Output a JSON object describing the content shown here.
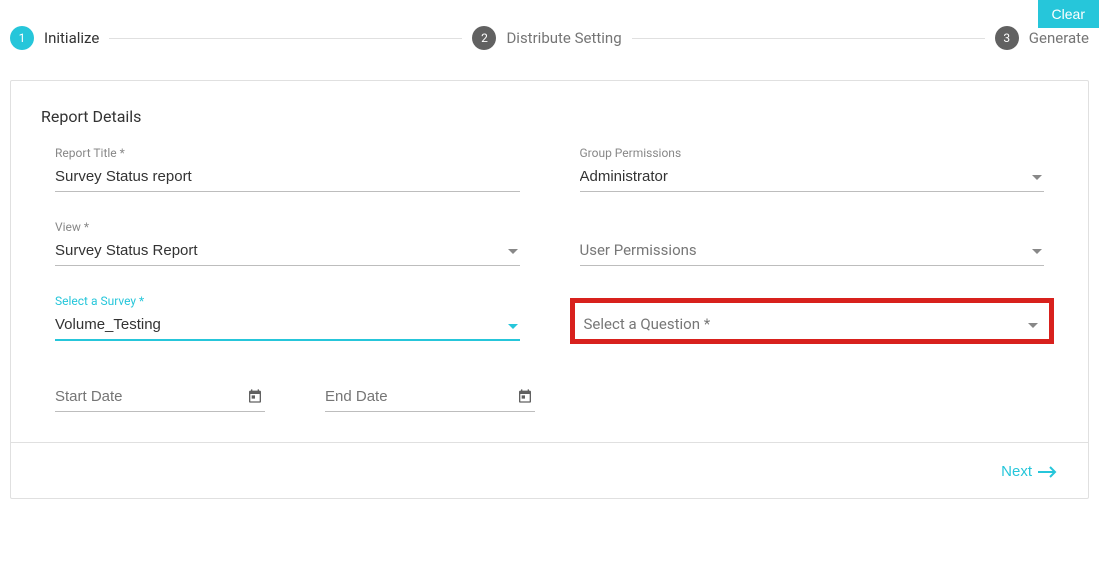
{
  "header": {
    "clear_label": "Clear"
  },
  "stepper": {
    "steps": [
      {
        "num": "1",
        "label": "Initialize",
        "active": true
      },
      {
        "num": "2",
        "label": "Distribute Setting",
        "active": false
      },
      {
        "num": "3",
        "label": "Generate",
        "active": false
      }
    ]
  },
  "card": {
    "title": "Report Details",
    "report_title_label": "Report Title *",
    "report_title_value": "Survey Status report",
    "group_perm_label": "Group Permissions",
    "group_perm_value": "Administrator",
    "view_label": "View *",
    "view_value": "Survey Status Report",
    "user_perm_placeholder": "User Permissions",
    "select_survey_label": "Select a Survey *",
    "select_survey_value": "Volume_Testing",
    "select_question_placeholder": "Select a Question *",
    "start_date_placeholder": "Start Date",
    "end_date_placeholder": "End Date"
  },
  "footer": {
    "next_label": "Next"
  }
}
